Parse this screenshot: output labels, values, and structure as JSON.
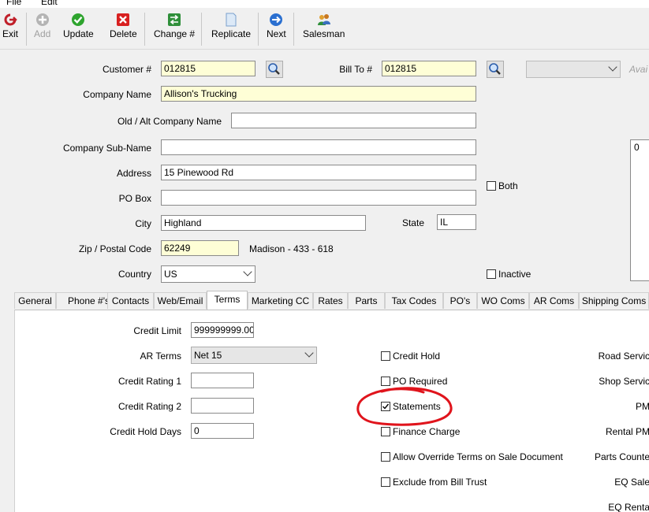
{
  "menu": {
    "file": "File",
    "edit": "Edit"
  },
  "toolbar": {
    "exit": "Exit",
    "add": "Add",
    "update": "Update",
    "delete": "Delete",
    "change": "Change #",
    "replicate": "Replicate",
    "next": "Next",
    "salesman": "Salesman"
  },
  "form": {
    "customer_label": "Customer #",
    "customer_value": "012815",
    "billto_label": "Bill To #",
    "billto_value": "012815",
    "avail_label": "Avai",
    "company_label": "Company Name",
    "company_value": "Allison's Trucking",
    "oldalt_label": "Old / Alt Company Name",
    "oldalt_value": "",
    "subname_label": "Company Sub-Name",
    "subname_value": "",
    "address_label": "Address",
    "address_value": "15 Pinewood Rd",
    "pobox_label": "PO Box",
    "pobox_value": "",
    "city_label": "City",
    "city_value": "Highland",
    "state_label": "State",
    "state_value": "IL",
    "zip_label": "Zip / Postal Code",
    "zip_value": "62249",
    "county_info": "Madison - 433 - 618",
    "country_label": "Country",
    "country_value": "US",
    "both_label": "Both",
    "inactive_label": "Inactive",
    "side_value": "0"
  },
  "tabs": [
    "General",
    "Phone #'s",
    "Contacts",
    "Web/Email",
    "Terms",
    "Marketing CC",
    "Rates",
    "Parts",
    "Tax Codes",
    "PO's",
    "WO Coms",
    "AR Coms",
    "Shipping Coms"
  ],
  "terms": {
    "credit_limit_label": "Credit Limit",
    "credit_limit_value": "999999999.00",
    "ar_terms_label": "AR Terms",
    "ar_terms_value": "Net 15",
    "credit_rating1_label": "Credit Rating 1",
    "credit_rating1_value": "",
    "credit_rating2_label": "Credit Rating 2",
    "credit_rating2_value": "",
    "credit_hold_days_label": "Credit Hold Days",
    "credit_hold_days_value": "0",
    "checkboxes": {
      "credit_hold": "Credit Hold",
      "po_required": "PO Required",
      "statements": "Statements",
      "finance_charge": "Finance Charge",
      "allow_override": "Allow Override Terms on Sale Document",
      "exclude_bill_trust": "Exclude from Bill Trust"
    },
    "statements_checked": true,
    "right_labels": [
      "Road Servic",
      "Shop Servic",
      "PM",
      "Rental PM",
      "Parts Counte",
      "EQ Sale",
      "EQ Renta"
    ]
  },
  "colors": {
    "required_field": "#fefed6",
    "annotation": "#e0141c"
  }
}
